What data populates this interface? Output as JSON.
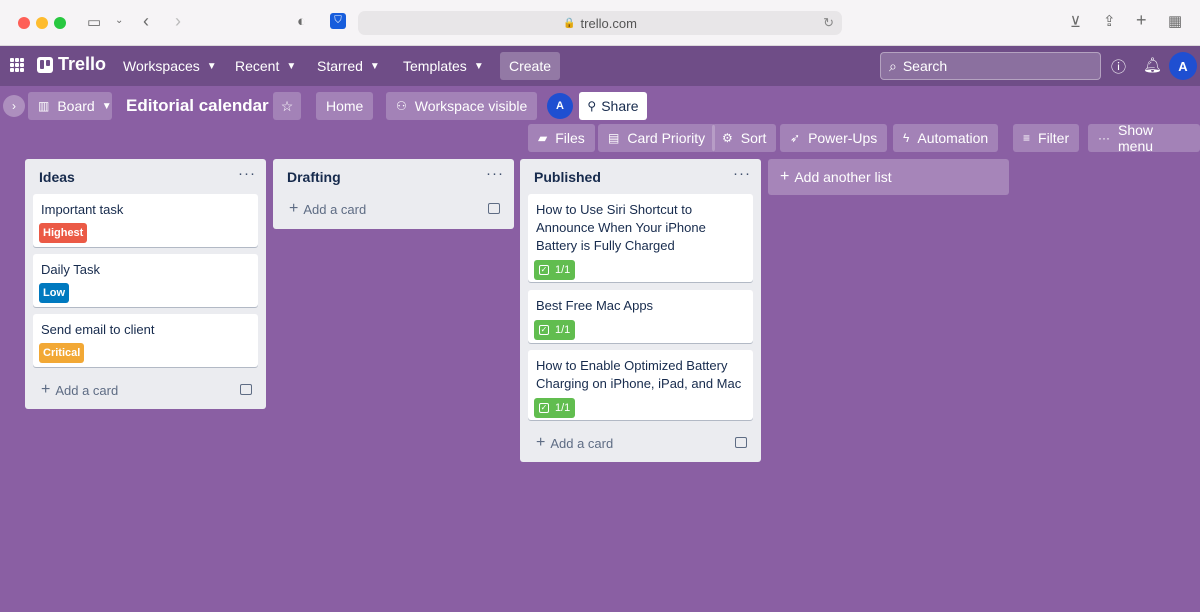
{
  "browser": {
    "url": "trello.com"
  },
  "header": {
    "logo": "Trello",
    "nav": [
      "Workspaces",
      "Recent",
      "Starred",
      "Templates"
    ],
    "create": "Create",
    "search_placeholder": "Search",
    "avatar": "A"
  },
  "board": {
    "view": "Board",
    "title": "Editorial calendar",
    "home": "Home",
    "visibility": "Workspace visible",
    "member_avatar": "A",
    "share": "Share",
    "toolbar": [
      "Files",
      "Card Priority",
      "Sort",
      "Power-Ups",
      "Automation",
      "Filter",
      "Show menu"
    ]
  },
  "lists": [
    {
      "name": "Ideas",
      "add_card": "Add a card",
      "cards": [
        {
          "title": "Important task",
          "label": "Highest",
          "label_color": "#eb5a46"
        },
        {
          "title": "Daily Task",
          "label": "Low",
          "label_color": "#0079bf"
        },
        {
          "title": "Send email to client",
          "label": "Critical",
          "label_color": "#f2a835"
        }
      ]
    },
    {
      "name": "Drafting",
      "add_card": "Add a card",
      "cards": []
    },
    {
      "name": "Published",
      "add_card": "Add a card",
      "cards": [
        {
          "title": "How to Use Siri Shortcut to Announce When Your iPhone Battery is Fully Charged",
          "checklist": "1/1"
        },
        {
          "title": "Best Free Mac Apps",
          "checklist": "1/1"
        },
        {
          "title": "How to Enable Optimized Battery Charging on iPhone, iPad, and Mac",
          "checklist": "1/1"
        }
      ]
    }
  ],
  "add_list": "Add another list",
  "colors": {
    "background": "#8a5fa3",
    "header": "#6f4d87",
    "checklist_done": "#61bd4f",
    "avatar": "#1f4fd1"
  }
}
